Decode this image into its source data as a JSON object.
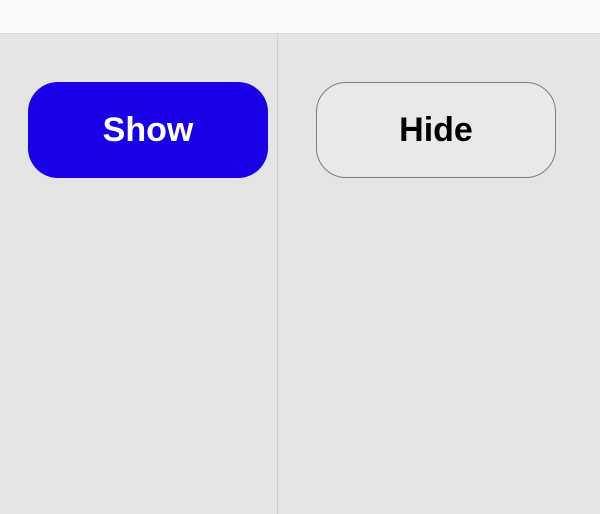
{
  "buttons": {
    "show": "Show",
    "hide": "Hide"
  }
}
